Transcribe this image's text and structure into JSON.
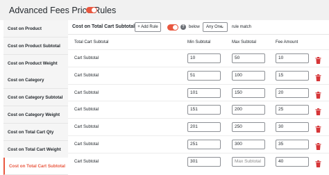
{
  "header": {
    "title": "Advanced Fees Price Rules"
  },
  "sidebar": {
    "items": [
      {
        "label": "Cost on Product"
      },
      {
        "label": "Cost on Product Subtotal"
      },
      {
        "label": "Cost on Product Weight"
      },
      {
        "label": "Cost on Category"
      },
      {
        "label": "Cost on Category Subtotal"
      },
      {
        "label": "Cost on Category Weight"
      },
      {
        "label": "Cost on Total Cart Qty"
      },
      {
        "label": "Cost on Total Cart Weight"
      },
      {
        "label": "Cost on Total Cart Subtotal"
      }
    ],
    "active_index": 8
  },
  "toolbar": {
    "title": "Cost on Total Cart Subtotal",
    "add_rule_label": "+ Add Rule",
    "help_glyph": "?",
    "below_label": "below",
    "match_value": "Any One",
    "rule_match_label": "rule match"
  },
  "table": {
    "headers": {
      "name": "Total Cart Subtotal",
      "min": "Min Subtotal",
      "max": "Max Subtotal",
      "fee": "Fee Amount"
    },
    "rows": [
      {
        "label": "Cart Subtotal",
        "min": "10",
        "max": "50",
        "max_placeholder": "Max Subtotal",
        "fee": "10"
      },
      {
        "label": "Cart Subtotal",
        "min": "51",
        "max": "100",
        "max_placeholder": "Max Subtotal",
        "fee": "15"
      },
      {
        "label": "Cart Subtotal",
        "min": "101",
        "max": "150",
        "max_placeholder": "Max Subtotal",
        "fee": "20"
      },
      {
        "label": "Cart Subtotal",
        "min": "151",
        "max": "200",
        "max_placeholder": "Max Subtotal",
        "fee": "25"
      },
      {
        "label": "Cart Subtotal",
        "min": "201",
        "max": "250",
        "max_placeholder": "Max Subtotal",
        "fee": "30"
      },
      {
        "label": "Cart Subtotal",
        "min": "251",
        "max": "300",
        "max_placeholder": "Max Subtotal",
        "fee": "35"
      },
      {
        "label": "Cart Subtotal",
        "min": "301",
        "max": "",
        "max_placeholder": "Max Subtotal",
        "fee": "40"
      }
    ]
  },
  "colors": {
    "accent": "#e9573f",
    "trash": "#d63638",
    "border": "#8c8f94"
  },
  "icons": {
    "delete": "trash-icon",
    "help": "help-icon",
    "dropdown": "chevron-down-icon"
  }
}
